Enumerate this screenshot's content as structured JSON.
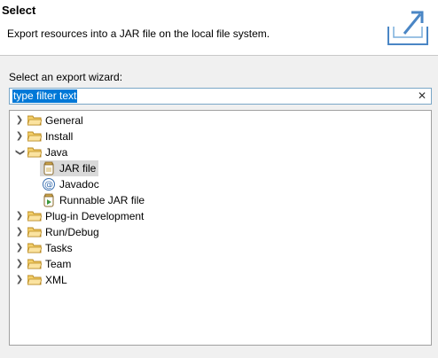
{
  "header": {
    "title": "Select",
    "description": "Export resources into a JAR file on the local file system."
  },
  "wizard_label": "Select an export wizard:",
  "filter": {
    "value": "type filter text",
    "clear_icon": "clear-icon"
  },
  "tree": {
    "items": [
      {
        "label": "General",
        "icon": "folder-icon",
        "expanded": false
      },
      {
        "label": "Install",
        "icon": "folder-icon",
        "expanded": false
      },
      {
        "label": "Java",
        "icon": "folder-icon",
        "expanded": true
      },
      {
        "label": "JAR file",
        "icon": "jar-icon",
        "selected": true
      },
      {
        "label": "Javadoc",
        "icon": "javadoc-icon"
      },
      {
        "label": "Runnable JAR file",
        "icon": "runnable-jar-icon"
      },
      {
        "label": "Plug-in Development",
        "icon": "folder-icon",
        "expanded": false
      },
      {
        "label": "Run/Debug",
        "icon": "folder-icon",
        "expanded": false
      },
      {
        "label": "Tasks",
        "icon": "folder-icon",
        "expanded": false
      },
      {
        "label": "Team",
        "icon": "folder-icon",
        "expanded": false
      },
      {
        "label": "XML",
        "icon": "folder-icon",
        "expanded": false
      }
    ]
  },
  "colors": {
    "selection": "#d9d9d9",
    "filter_highlight": "#0078d7",
    "folder": "#e8b84a"
  }
}
